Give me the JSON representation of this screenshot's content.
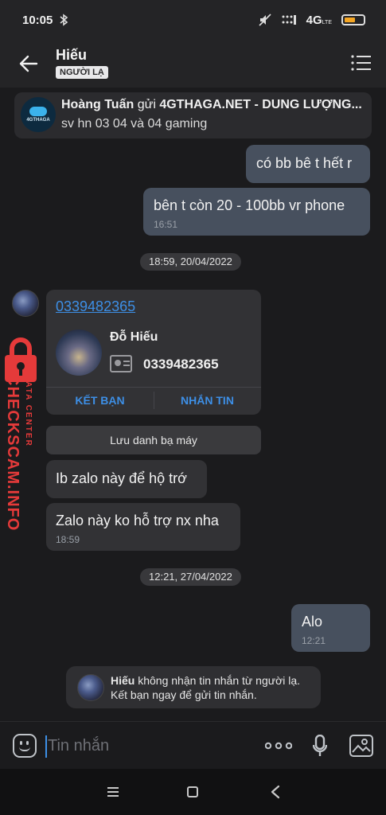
{
  "status_bar": {
    "time": "10:05",
    "network": "4G",
    "network_sup": "LTE",
    "battery_level": 0.6
  },
  "header": {
    "title": "Hiếu",
    "badge": "NGƯỜI LẠ"
  },
  "pinned": {
    "sender": "Hoàng Tuấn",
    "verb": "gửi",
    "subject": "4GTHAGA.NET - DUNG LƯỢNG...",
    "preview": "sv hn 03 04 và 04 gaming",
    "logo_text": "4GTHAGA"
  },
  "messages": {
    "out1": "có bb bê t hết r",
    "out2": "bên t còn 20 - 100bb vr phone",
    "out2_time": "16:51",
    "date1": "18:59, 20/04/2022",
    "contact_link": "0339482365",
    "contact_name": "Đỗ Hiếu",
    "contact_phone": "0339482365",
    "contact_add": "KẾT BẠN",
    "contact_msg": "NHẮN TIN",
    "save_contact": "Lưu danh bạ máy",
    "in1": "Ib zalo này để hộ trớ",
    "in2": "Zalo này ko hỗ trợ nx nha",
    "in2_time": "18:59",
    "date2": "12:21, 27/04/2022",
    "out3": "Alo",
    "out3_time": "12:21"
  },
  "notice": {
    "name": "Hiếu",
    "line1": "không nhận tin nhắn từ người lạ.",
    "line2": "Kết bạn ngay để gửi tin nhắn."
  },
  "composer": {
    "placeholder": "Tin nhắn"
  },
  "watermark": {
    "main": "CHECKSCAM.INFO",
    "sub": "DATA CENTER"
  },
  "colors": {
    "accent": "#3d8fe6",
    "outgoing": "#47505e",
    "incoming": "#323235",
    "watermark": "#e53a3a"
  }
}
